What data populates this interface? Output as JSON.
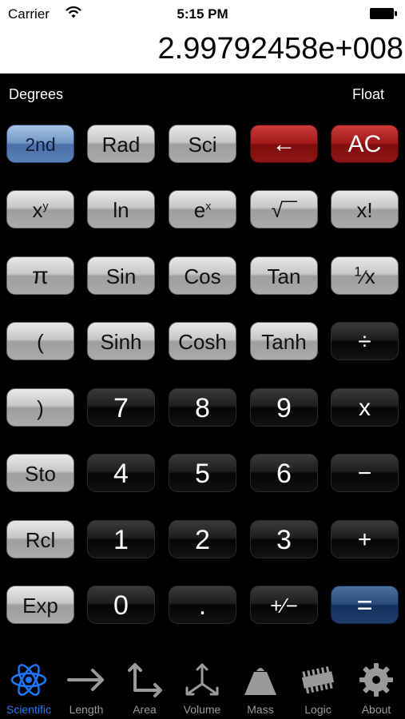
{
  "status": {
    "carrier": "Carrier",
    "time": "5:15 PM"
  },
  "display": {
    "value": "2.99792458e+008"
  },
  "modes": {
    "angle": "Degrees",
    "format": "Float"
  },
  "keys": {
    "second": "2nd",
    "rad": "Rad",
    "sci": "Sci",
    "backspace": "←",
    "clear": "AC",
    "pow": "x",
    "pow_sup": "y",
    "ln": "ln",
    "exp": "e",
    "exp_sup": "x",
    "sqrt": "√‾‾",
    "fact": "x!",
    "pi": "π",
    "sin": "Sin",
    "cos": "Cos",
    "tan": "Tan",
    "recip_num": "1",
    "recip_den": "x",
    "lparen": "(",
    "sinh": "Sinh",
    "cosh": "Cosh",
    "tanh": "Tanh",
    "divide": "÷",
    "rparen": ")",
    "d7": "7",
    "d8": "8",
    "d9": "9",
    "multiply": "x",
    "sto": "Sto",
    "d4": "4",
    "d5": "5",
    "d6": "6",
    "minus": "−",
    "rcl": "Rcl",
    "d1": "1",
    "d2": "2",
    "d3": "3",
    "plus": "+",
    "exp_key": "Exp",
    "d0": "0",
    "dot": ".",
    "sign": "+⁄−",
    "equals": "="
  },
  "tabs": [
    {
      "label": "Scientific",
      "icon": "atom-icon",
      "active": true
    },
    {
      "label": "Length",
      "icon": "arrow-right-icon",
      "active": false
    },
    {
      "label": "Area",
      "icon": "axes-2d-icon",
      "active": false
    },
    {
      "label": "Volume",
      "icon": "axes-3d-icon",
      "active": false
    },
    {
      "label": "Mass",
      "icon": "weight-icon",
      "active": false
    },
    {
      "label": "Logic",
      "icon": "chip-icon",
      "active": false
    },
    {
      "label": "About",
      "icon": "gear-icon",
      "active": false
    }
  ],
  "colors": {
    "active_tab": "#1e78ff",
    "inactive_tab": "#9a9a9a",
    "background": "#000000"
  }
}
